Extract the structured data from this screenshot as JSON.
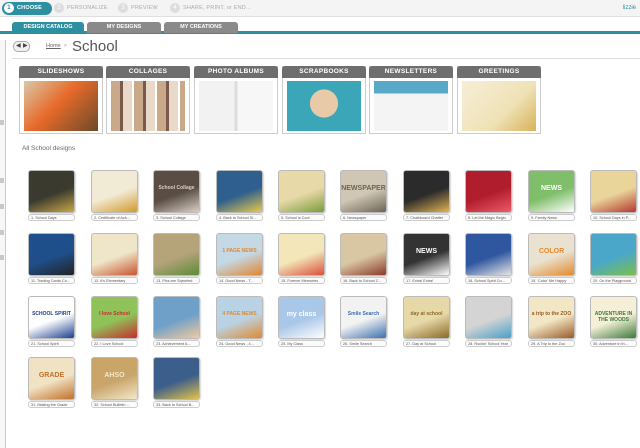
{
  "wizard": {
    "steps": [
      {
        "num": "1",
        "label": "CHOOSE"
      },
      {
        "num": "2",
        "label": "PERSONALIZE"
      },
      {
        "num": "3",
        "label": "PREVIEW"
      },
      {
        "num": "4",
        "label": "SHARE, PRINT, or END..."
      }
    ],
    "user_link": "lizzie"
  },
  "tabs": [
    {
      "label": "DESIGN CATALOG"
    },
    {
      "label": "MY DESIGNS"
    },
    {
      "label": "MY CREATIONS"
    }
  ],
  "breadcrumb": {
    "home": "Home",
    "separator": ">"
  },
  "page_title": "School",
  "categories": [
    {
      "label": "SLIDESHOWS"
    },
    {
      "label": "COLLAGES"
    },
    {
      "label": "PHOTO ALBUMS"
    },
    {
      "label": "SCRAPBOOKS"
    },
    {
      "label": "NEWSLETTERS"
    },
    {
      "label": "GREETINGS"
    }
  ],
  "section_label": "All School designs",
  "designs": [
    {
      "caption": "1. School Days",
      "bg": "#3a3a2e",
      "accent": "#c8a648",
      "text": ""
    },
    {
      "caption": "2. Certificate of Ach...",
      "bg": "#f1ead4",
      "accent": "#d39a2c",
      "text": ""
    },
    {
      "caption": "3. School Collage",
      "bg": "#5a4e44",
      "accent": "#d9cfc3",
      "text": "School Collage"
    },
    {
      "caption": "4. Back to School Sl...",
      "bg": "#2e5f8e",
      "accent": "#e7c94b",
      "text": ""
    },
    {
      "caption": "5. School is Cool",
      "bg": "#e8d9a8",
      "accent": "#7a9c3a",
      "text": ""
    },
    {
      "caption": "6. Newspaper",
      "bg": "#cfc6b4",
      "accent": "#6b6456",
      "text": "NEWSPAPER"
    },
    {
      "caption": "7. Chalkboard Chatter",
      "bg": "#2b2b2b",
      "accent": "#e1b354",
      "text": ""
    },
    {
      "caption": "8. Let the Magic Begin",
      "bg": "#b01d2c",
      "accent": "#f05a6a",
      "text": ""
    },
    {
      "caption": "9. Family News",
      "bg": "#7fbf6a",
      "accent": "#ffffff",
      "text": "NEWS"
    },
    {
      "caption": "10. School Days in P...",
      "bg": "#e9d59a",
      "accent": "#b5362f",
      "text": ""
    },
    {
      "caption": "11. Trading Cards Co...",
      "bg": "#1f4f8a",
      "accent": "#222222",
      "text": ""
    },
    {
      "caption": "12. It's Elementary",
      "bg": "#efe5c8",
      "accent": "#c9542e",
      "text": ""
    },
    {
      "caption": "13. Pics are Sqrueled",
      "bg": "#b5a37a",
      "accent": "#5c8b3a",
      "text": ""
    },
    {
      "caption": "14. Good News - T...",
      "bg": "#c4d8e6",
      "accent": "#e0872e",
      "text": "1 PAGE NEWS"
    },
    {
      "caption": "15. Forever Memories",
      "bg": "#f3e6b8",
      "accent": "#d8503a",
      "text": ""
    },
    {
      "caption": "16. Back to School C...",
      "bg": "#d9c7a3",
      "accent": "#8a3a2a",
      "text": ""
    },
    {
      "caption": "17. Extra! Extra!",
      "bg": "#333333",
      "accent": "#ffffff",
      "text": "NEWS"
    },
    {
      "caption": "18. School Spirit Co...",
      "bg": "#2f57a0",
      "accent": "#e6e6e6",
      "text": ""
    },
    {
      "caption": "19. 'Color' Me Happy",
      "bg": "#e9e2d1",
      "accent": "#e48a2b",
      "text": "COLOR"
    },
    {
      "caption": "20. On the Playground",
      "bg": "#4aa7c9",
      "accent": "#7bbf4a",
      "text": ""
    },
    {
      "caption": "21. School Spirit",
      "bg": "#ffffff",
      "accent": "#1c3f8f",
      "text": "SCHOOL SPIRIT"
    },
    {
      "caption": "22. I Love School",
      "bg": "#8fc35a",
      "accent": "#c62d2d",
      "text": "I love School"
    },
    {
      "caption": "23. Achievement A...",
      "bg": "#6ea0c8",
      "accent": "#f2c9a0",
      "text": ""
    },
    {
      "caption": "24. Good News - 4...",
      "bg": "#bad3e4",
      "accent": "#e08a2f",
      "text": "4 PAGE NEWS"
    },
    {
      "caption": "25. My Class",
      "bg": "#a9c7e8",
      "accent": "#ffffff",
      "text": "my class"
    },
    {
      "caption": "26. Smile Search",
      "bg": "#f2f2f2",
      "accent": "#3a6fb0",
      "text": "Smile Search"
    },
    {
      "caption": "27. Day at School",
      "bg": "#e7d8a8",
      "accent": "#8a6a2a",
      "text": "day at school"
    },
    {
      "caption": "28. Rockin' School Year",
      "bg": "#d4d4d4",
      "accent": "#4aa0c8",
      "text": ""
    },
    {
      "caption": "29. A Trip to the Zoo",
      "bg": "#f2e7c4",
      "accent": "#9a5a2a",
      "text": "a trip to the ZOO"
    },
    {
      "caption": "30. Adventure in th...",
      "bg": "#f4efd6",
      "accent": "#3a7a3a",
      "text": "ADVENTURE IN THE WOODS"
    },
    {
      "caption": "31. Making the Grade",
      "bg": "#f0e3c4",
      "accent": "#c2712a",
      "text": "GRADE"
    },
    {
      "caption": "32. School Bulletin ...",
      "bg": "#c9a56a",
      "accent": "#f2e9c9",
      "text": "AHSO"
    },
    {
      "caption": "33. Back to School B...",
      "bg": "#3b5e8a",
      "accent": "#e3c24a",
      "text": ""
    }
  ]
}
